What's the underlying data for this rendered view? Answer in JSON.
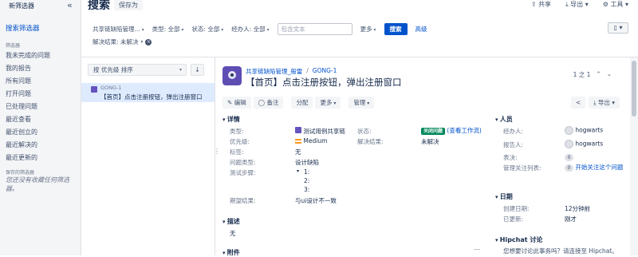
{
  "sidebar": {
    "new_filter": "新筛选器",
    "collapse_icon": "«",
    "search_filters": "搜索筛选器",
    "filters_title": "筛选器",
    "items": [
      {
        "label": "我未完成的问题"
      },
      {
        "label": "我的报告"
      },
      {
        "label": "所有问题"
      },
      {
        "label": "打开问题"
      },
      {
        "label": "已处理问题"
      },
      {
        "label": "最近查看"
      },
      {
        "label": "最近创立的"
      },
      {
        "label": "最近解决的"
      },
      {
        "label": "最近更新的"
      }
    ],
    "saved_title": "保存的筛选器",
    "saved_empty": "您还没有收藏任何筛选器。"
  },
  "header": {
    "title": "搜索",
    "save_as": "保存为",
    "share": "共享",
    "export": "导出",
    "tools": "工具"
  },
  "filters": {
    "project": "共享链缺陷管理...",
    "type": "类型: 全部",
    "status": "状态: 全部",
    "assignee": "经办人: 全部",
    "text_placeholder": "包含文本",
    "more": "更多",
    "search": "搜索",
    "advanced": "高级",
    "resolution": "解决结果: 未解决"
  },
  "list": {
    "order_by": "按 优先级 排序",
    "order_dir": "↓",
    "items": [
      {
        "key": "GONG-1",
        "summary": "【首页】点击注册按钮，弹出注册窗口"
      }
    ]
  },
  "issue": {
    "project": "共享链缺陷管理_般雷",
    "key": "GONG-1",
    "title": "【首页】点击注册按钮，弹出注册窗口",
    "pager": "1 之 1",
    "ops": {
      "edit": "编辑",
      "comment": "备注",
      "assign": "分配",
      "more": "更多",
      "admin": "管理",
      "export": "导出"
    },
    "details_title": "详情",
    "fields": {
      "type_label": "类型:",
      "type_value": "测试用例共享链",
      "priority_label": "优先级:",
      "priority_value": "Medium",
      "labels_label": "标签:",
      "labels_value": "无",
      "issue_type_label": "问题类型:",
      "issue_type_value": "设计缺陷",
      "steps_label": "测试步骤:",
      "steps": [
        "1:",
        "2:",
        "3:"
      ],
      "expected_label": "期望结果:",
      "expected_value": "与ui设计不一致",
      "status_label": "状态:",
      "status_value": "关闭问题",
      "status_link": "(查看工作流)",
      "resolution_label": "解决结果:",
      "resolution_value": "未解决"
    },
    "description_title": "描述",
    "description_value": "无",
    "attachments_title": "附件"
  },
  "people": {
    "title": "人员",
    "assignee_label": "经办人:",
    "assignee": "hogwarts",
    "reporter_label": "报告人:",
    "reporter": "hogwarts",
    "votes_label": "表决:",
    "votes": "0",
    "watchers_label": "管理关注列表:",
    "watchers": "0",
    "watch_link": "开始关注这个问题"
  },
  "dates": {
    "title": "日期",
    "created_label": "创建日期:",
    "created": "12分钟前",
    "updated_label": "已更新:",
    "updated": "刚才"
  },
  "hipchat": {
    "title": "Hipchat 讨论",
    "text": "您想要讨论此事务吗？请连接至 Hipchat。"
  },
  "colors": {
    "brand": "#0052cc",
    "status_done": "#00875a",
    "selected_row": "#deebff"
  }
}
